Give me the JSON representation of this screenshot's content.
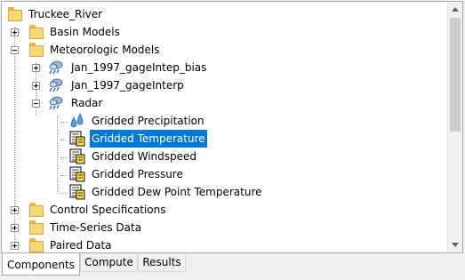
{
  "tree": {
    "root": {
      "label": "Truckee_River",
      "icon": "folder-icon"
    },
    "nodes": [
      {
        "label": "Basin Models",
        "icon": "folder-icon",
        "expander": "plus"
      },
      {
        "label": "Meteorologic Models",
        "icon": "folder-icon",
        "expander": "minus"
      },
      {
        "label": "Jan_1997_gageIntep_bias",
        "icon": "meteorologic-model-icon",
        "expander": "plus"
      },
      {
        "label": "Jan_1997_gageInterp",
        "icon": "meteorologic-model-icon",
        "expander": "plus"
      },
      {
        "label": "Radar",
        "icon": "meteorologic-model-icon",
        "expander": "minus"
      },
      {
        "label": "Gridded Precipitation",
        "icon": "precipitation-icon"
      },
      {
        "label": "Gridded Temperature",
        "icon": "gridded-data-icon",
        "selected": true
      },
      {
        "label": "Gridded Windspeed",
        "icon": "gridded-data-icon"
      },
      {
        "label": "Gridded Pressure",
        "icon": "gridded-data-icon"
      },
      {
        "label": "Gridded Dew Point Temperature",
        "icon": "gridded-data-icon"
      },
      {
        "label": "Control Specifications",
        "icon": "folder-icon",
        "expander": "plus"
      },
      {
        "label": "Time-Series Data",
        "icon": "folder-icon",
        "expander": "plus"
      },
      {
        "label": "Paired Data",
        "icon": "folder-icon",
        "expander": "plus"
      }
    ]
  },
  "tabs": [
    {
      "label": "Components",
      "active": true
    },
    {
      "label": "Compute",
      "active": false
    },
    {
      "label": "Results",
      "active": false
    }
  ],
  "colors": {
    "selection": "#0078d7",
    "folder": "#f8d775"
  }
}
